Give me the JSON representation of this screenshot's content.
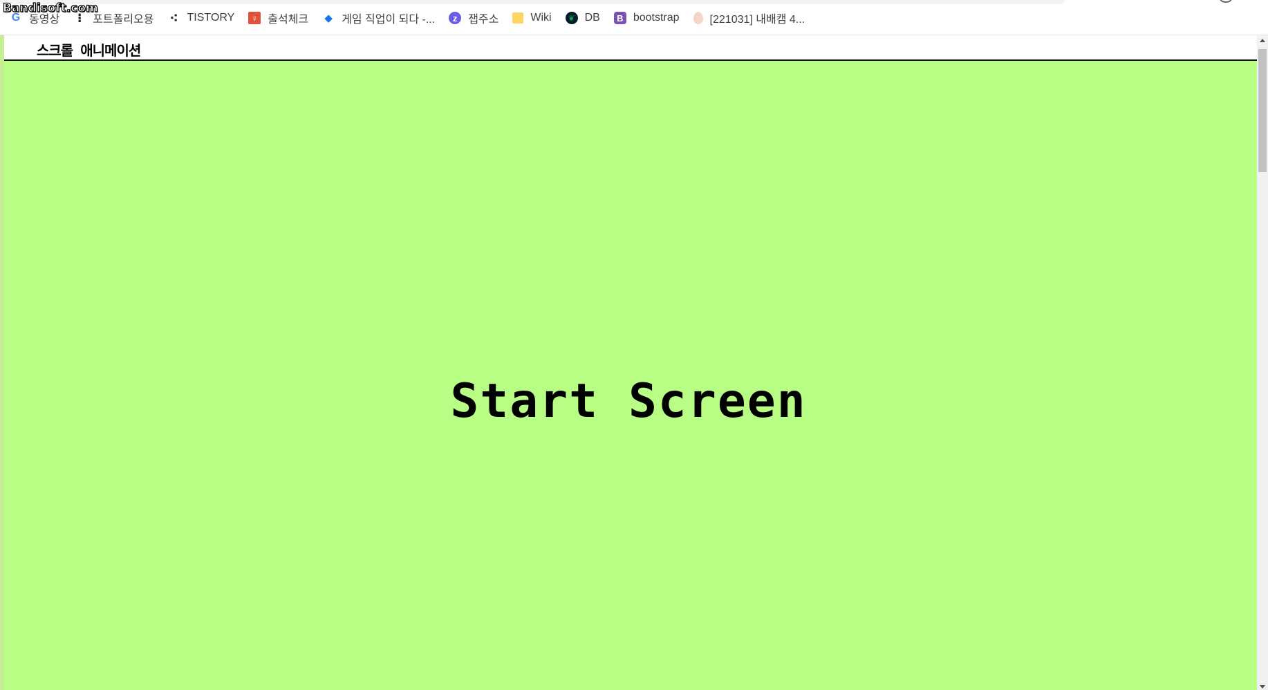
{
  "watermark": "Bandisoft.com",
  "bookmarks": [
    {
      "label": "동영상",
      "icon": "google-icon",
      "glyph": "G",
      "color": "#4285f4"
    },
    {
      "label": "포트폴리오용",
      "icon": "dots-icon",
      "glyph": "⁝",
      "color": "#202124"
    },
    {
      "label": "TISTORY",
      "icon": "tistory-icon",
      "glyph": "⁖",
      "color": "#202124"
    },
    {
      "label": "출석체크",
      "icon": "attendance-icon",
      "glyph": "♀",
      "color": "#e0533a"
    },
    {
      "label": "게임 직업이 되다 -...",
      "icon": "game-job-icon",
      "glyph": "◆",
      "color": "#1a73e8"
    },
    {
      "label": "잽주소",
      "icon": "zap-icon",
      "glyph": "z",
      "color": "#6c5ce7"
    },
    {
      "label": "Wiki",
      "icon": "folder-icon",
      "glyph": "",
      "color": "#fdd663"
    },
    {
      "label": "DB",
      "icon": "mongodb-leaf-icon",
      "glyph": "❦",
      "color": "#13aa52"
    },
    {
      "label": "bootstrap",
      "icon": "bootstrap-icon",
      "glyph": "B",
      "color": "#7952b3"
    },
    {
      "label": "[221031] 내배캠 4...",
      "icon": "egg-icon",
      "glyph": "",
      "color": "#f6d5c6"
    }
  ],
  "page": {
    "nav_title": "스크롤 애니메이션",
    "center_text": "Start Screen",
    "background": "#b8fd84"
  }
}
